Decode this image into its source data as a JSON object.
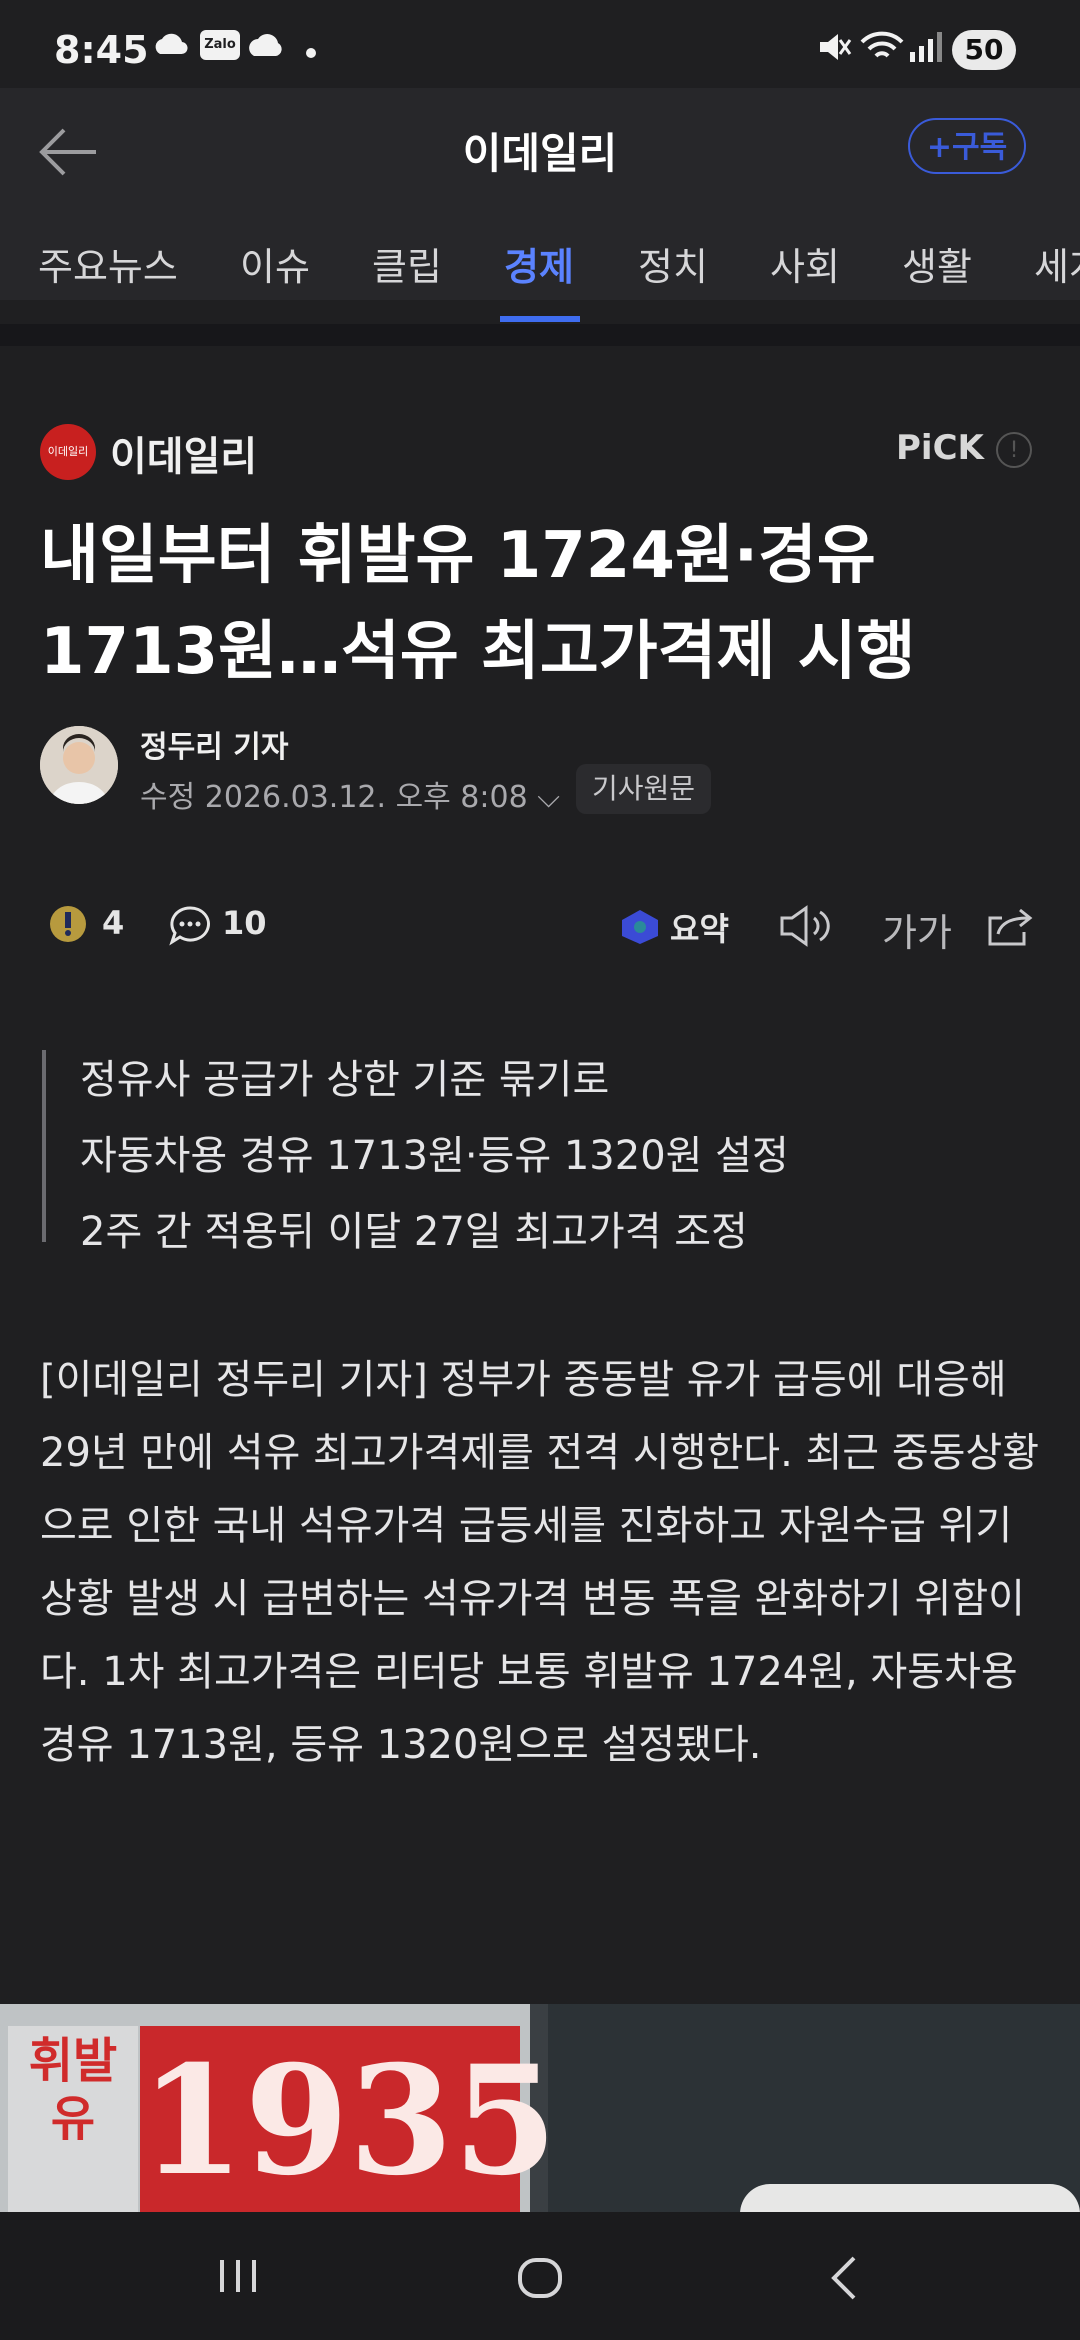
{
  "status_bar": {
    "time": "8:45",
    "icons": [
      "cloud-icon",
      "zalo-icon",
      "cloud-icon",
      "dot-icon",
      "mute-icon",
      "wifi-icon",
      "signal-icon"
    ],
    "battery": "50"
  },
  "header": {
    "title": "이데일리",
    "subscribe_label": "+구독"
  },
  "tabs": [
    "주요뉴스",
    "이슈",
    "클립",
    "경제",
    "정치",
    "사회",
    "생활",
    "세계"
  ],
  "active_tab": "경제",
  "article": {
    "publisher": "이데일리",
    "publisher_logo_text": "이데일리",
    "pick_label": "PiCK",
    "headline": "내일부터 휘발유 1724원·경유 1713원…석유 최고가격제 시행",
    "reporter": "정두리 기자",
    "dateline": "수정 2026.03.12. 오후 8:08",
    "original_label": "기사원문",
    "reactions": {
      "count": "4",
      "comments": "10"
    },
    "summary_label": "요약",
    "font_size_label": "가가",
    "quote_lines": [
      "정유사 공급가 상한 기준 묶기로",
      "자동차용 경유 1713원·등유 1320원 설정",
      "2주 간 적용뒤 이달 27일 최고가격 조정"
    ],
    "body": "[이데일리 정두리 기자] 정부가 중동발 유가 급등에 대응해 29년 만에 석유 최고가격제를 전격 시행한다. 최근 중동상황으로 인한 국내 석유가격 급등세를 진화하고 자원수급 위기 상황 발생 시 급변하는 석유가격 변동 폭을 완화하기 위함이다. 1차 최고가격은 리터당 보통 휘발유 1724원, 자동차용 경유 1713원, 등유 1320원으로 설정됐다."
  },
  "photo": {
    "sign_label": "휘발유",
    "sign_price": "1935"
  },
  "colors": {
    "background": "#1f1f21",
    "accent": "#3f6df0",
    "logo_red": "#c8201f"
  }
}
